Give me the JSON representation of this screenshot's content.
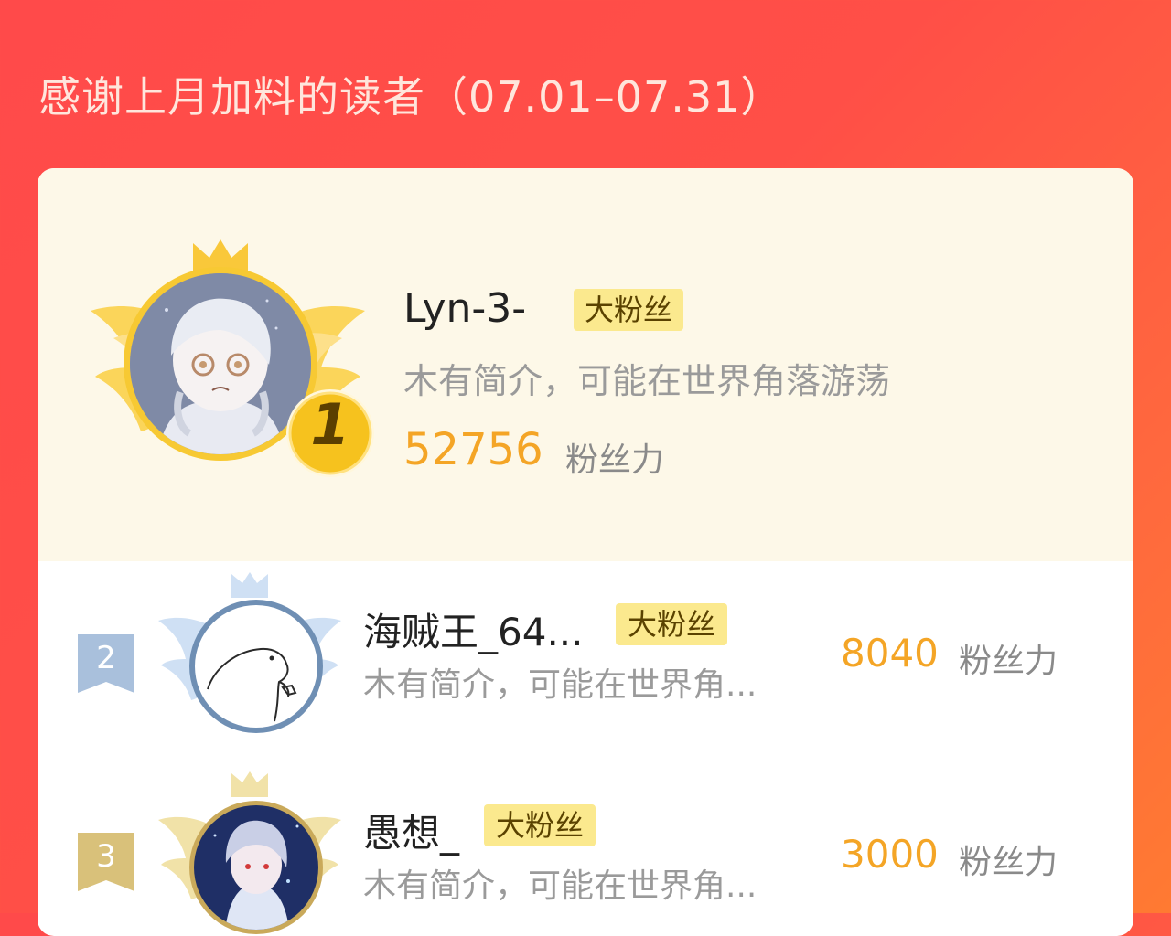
{
  "page": {
    "title": "感谢上月加料的读者（07.01–07.31）"
  },
  "colors": {
    "background": "#ff4f47",
    "accent_orange": "#f4a526",
    "badge_yellow": "#fbe98e",
    "gold": "#f5c02e",
    "silver": "#a9c0dc",
    "bronze": "#d9c17a"
  },
  "leaderboard": [
    {
      "rank": "1",
      "name": "Lyn-3-",
      "badge": "大粉丝",
      "bio": "木有简介，可能在世界角落游荡",
      "score": "52756",
      "score_unit": "粉丝力",
      "medal": "gold-crown-wings"
    },
    {
      "rank": "2",
      "name": "海贼王_64...",
      "badge": "大粉丝",
      "bio": "木有简介，可能在世界角...",
      "score": "8040",
      "score_unit": "粉丝力",
      "medal": "silver-crown-wings"
    },
    {
      "rank": "3",
      "name": "愚想_",
      "badge": "大粉丝",
      "bio": "木有简介，可能在世界角...",
      "score": "3000",
      "score_unit": "粉丝力",
      "medal": "bronze-crown-wings"
    }
  ]
}
